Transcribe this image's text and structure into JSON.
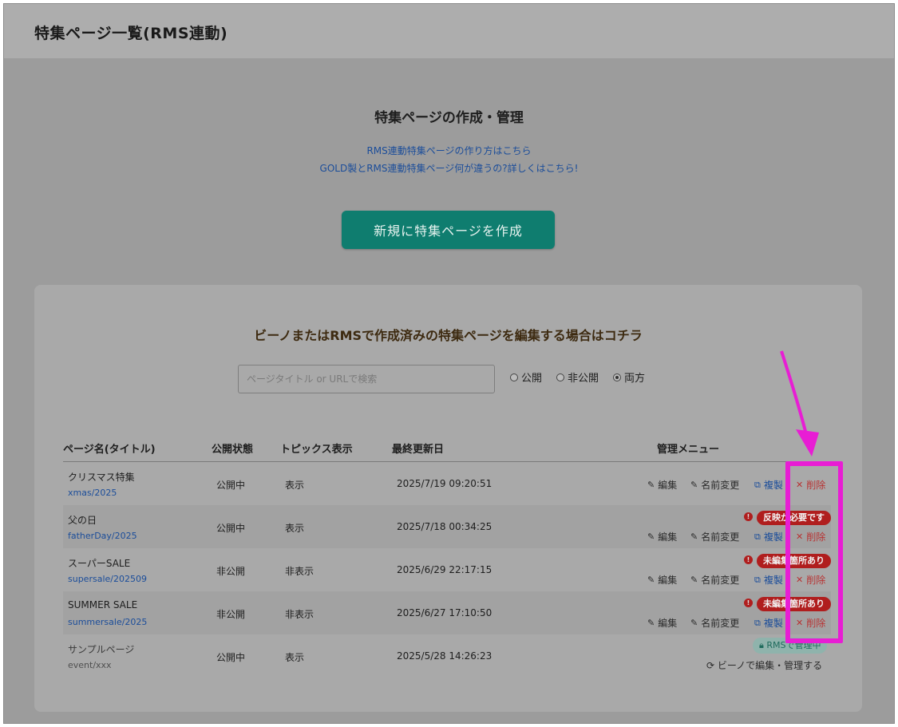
{
  "header": {
    "title": "特集ページ一覧(RMS連動)"
  },
  "section": {
    "title": "特集ページの作成・管理",
    "help_links": [
      "RMS連動特集ページの作り方はこちら",
      "GOLD製とRMS連動特集ページ何が違うの?詳しくはこちら!"
    ],
    "create_button": "新規に特集ページを作成"
  },
  "card": {
    "title": "ビーノまたはRMSで作成済みの特集ページを編集する場合はコチラ",
    "search_placeholder": "ページタイトル or URLで検索",
    "radios": [
      {
        "label": "公開",
        "checked": false
      },
      {
        "label": "非公開",
        "checked": false
      },
      {
        "label": "両方",
        "checked": true
      }
    ]
  },
  "table": {
    "headers": [
      "ページ名(タイトル)",
      "公開状態",
      "トピックス表示",
      "最終更新日",
      "管理メニュー"
    ],
    "menu_labels": {
      "edit": "編集",
      "rename": "名前変更",
      "copy": "複製",
      "delete": "削除"
    },
    "rows": [
      {
        "name": "クリスマス特集",
        "slug": "xmas/2025",
        "status": "公開中",
        "topics": "表示",
        "updated": "2025/7/19 09:20:51",
        "badge": ""
      },
      {
        "name": "父の日",
        "slug": "fatherDay/2025",
        "status": "公開中",
        "topics": "表示",
        "updated": "2025/7/18 00:34:25",
        "badge": "反映が必要です"
      },
      {
        "name": "スーパーSALE",
        "slug": "supersale/202509",
        "status": "非公開",
        "topics": "非表示",
        "updated": "2025/6/29 22:17:15",
        "badge": "未編集箇所あり"
      },
      {
        "name": "SUMMER SALE",
        "slug": "summersale/2025",
        "status": "非公開",
        "topics": "非表示",
        "updated": "2025/6/27 17:10:50",
        "badge": "未編集箇所あり"
      },
      {
        "name": "サンプルページ",
        "slug": "event/xxx",
        "status": "公開中",
        "topics": "表示",
        "updated": "2025/5/28 14:26:23",
        "rms_badge": "RMSで管理中",
        "bino_link": "ビーノで編集・管理する"
      }
    ]
  },
  "colors": {
    "accent": "#0f7d6f",
    "danger": "#b01e1e",
    "link": "#1b4d9a",
    "highlight": "#e81dd4"
  }
}
